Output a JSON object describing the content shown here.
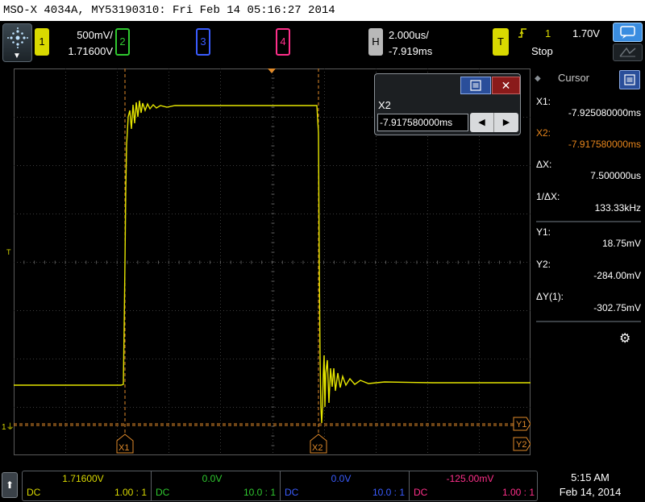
{
  "title": "MSO-X 4034A, MY53190310: Fri Feb 14 05:16:27 2014",
  "channels": [
    {
      "id": "1",
      "scale": "500mV/",
      "offset": "1.71600V",
      "color": "#d9d900"
    },
    {
      "id": "2",
      "color": "#2fc82f"
    },
    {
      "id": "3",
      "color": "#3a5cff"
    },
    {
      "id": "4",
      "color": "#ff2f8a"
    }
  ],
  "horizontal": {
    "label": "H",
    "scale": "2.000us/",
    "position": "-7.919ms"
  },
  "trigger": {
    "label": "T",
    "edge": "rising-edge-icon",
    "source": "1",
    "level": "1.70V",
    "status": "Stop"
  },
  "graticule": {
    "marker_t": "T",
    "marker_gnd": "1",
    "markers": {
      "y1": "Y1",
      "y2": "Y2",
      "x1": "X1",
      "x2": "X2"
    }
  },
  "cursor_popup": {
    "label": "X2",
    "value": "-7.917580000ms"
  },
  "cursor_panel": {
    "title": "Cursor",
    "x1_label": "X1:",
    "x1_value": "-7.925080000ms",
    "x2_label": "X2:",
    "x2_value": "-7.917580000ms",
    "dx_label": "ΔX:",
    "dx_value": "7.500000us",
    "inv_dx_label": "1/ΔX:",
    "inv_dx_value": "133.33kHz",
    "y1_label": "Y1:",
    "y1_value": "18.75mV",
    "y2_label": "Y2:",
    "y2_value": "-284.00mV",
    "dy_label": "ΔY(1):",
    "dy_value": "-302.75mV"
  },
  "bottom": {
    "ch1": {
      "offset": "1.71600V",
      "coupling": "DC",
      "probe": "1.00 : 1"
    },
    "ch2": {
      "offset": "0.0V",
      "coupling": "DC",
      "probe": "10.0 : 1"
    },
    "ch3": {
      "offset": "0.0V",
      "coupling": "DC",
      "probe": "10.0 : 1"
    },
    "ch4": {
      "offset": "-125.00mV",
      "coupling": "DC",
      "probe": "1.00 : 1"
    },
    "time": "5:15 AM",
    "date": "Feb 14, 2014"
  }
}
